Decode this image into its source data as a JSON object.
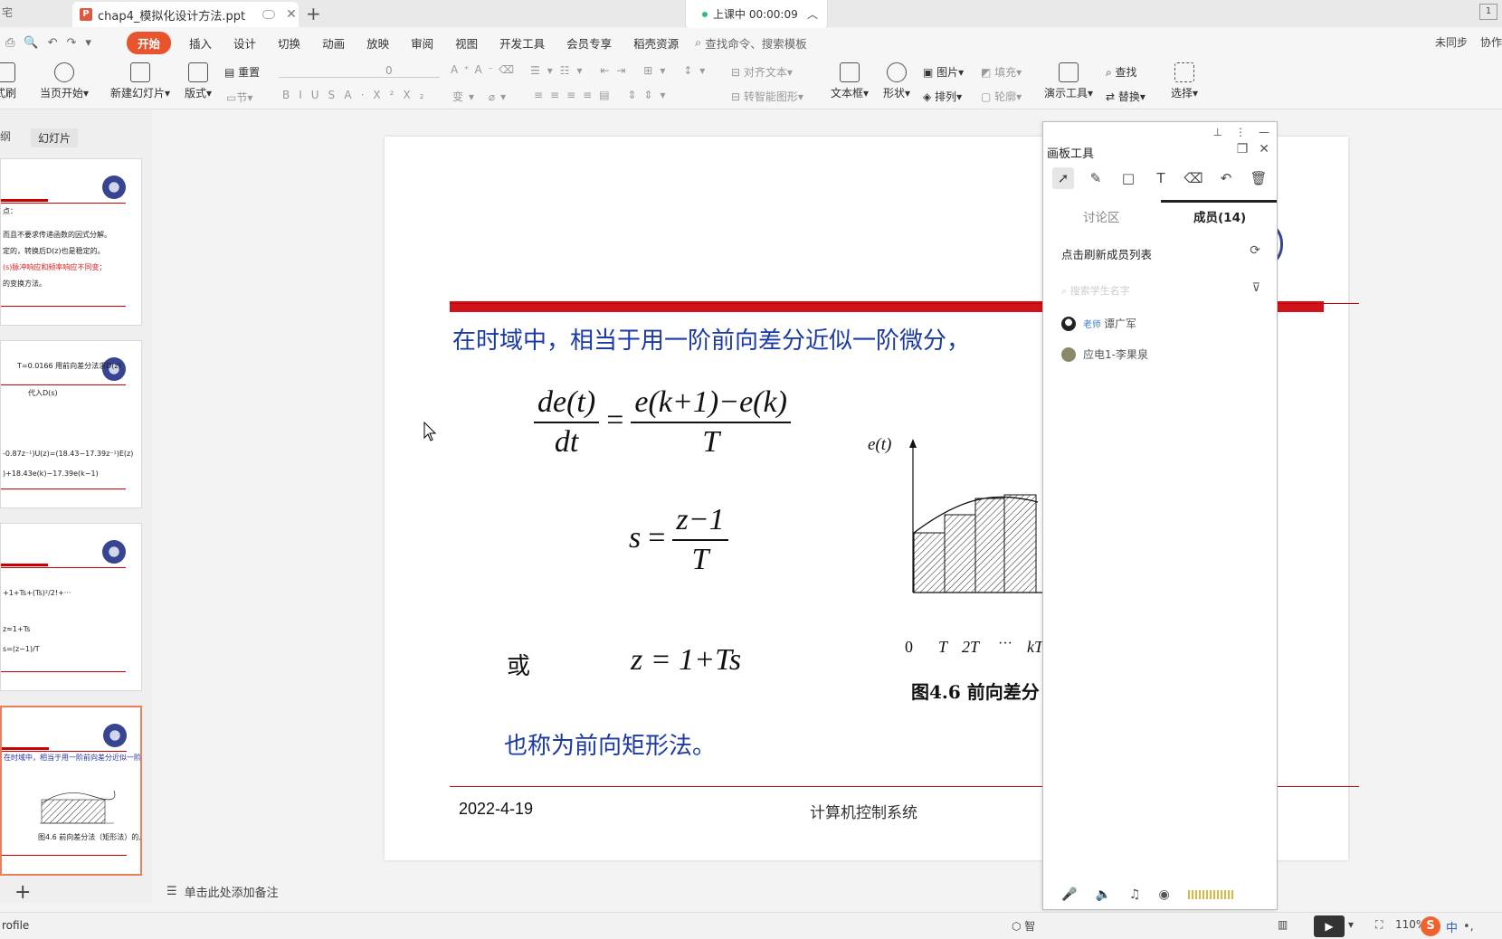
{
  "titlebar": {
    "prev_tab": "宅",
    "active_tab": "chap4_模拟化设计方法.ppt",
    "new_tab": "+",
    "class_status": "上课中 00:00:09",
    "right_badge": "1"
  },
  "menubar": {
    "items": [
      "开始",
      "插入",
      "设计",
      "切换",
      "动画",
      "放映",
      "审阅",
      "视图",
      "开发工具",
      "会员专享",
      "稻壳资源"
    ],
    "search": "查找命令、搜索模板",
    "right": [
      "未同步",
      "协作"
    ]
  },
  "ribbon": {
    "format_painter": "式刷",
    "play_current": "当页开始",
    "new_slide": "新建幻灯片",
    "layout": "版式",
    "reset": "重置",
    "section": "节",
    "font_size": "0",
    "align_text": "对齐文本",
    "convert_smartart": "转智能图形",
    "textbox": "文本框",
    "shape": "形状",
    "picture": "图片",
    "arrange": "排列",
    "fill": "填充",
    "outline": "轮廓",
    "present_tool": "演示工具",
    "find": "查找",
    "replace": "替换",
    "select": "选择"
  },
  "leftpanel": {
    "tabs": [
      "纲",
      "幻灯片"
    ],
    "thumb1": {
      "l1": "点：",
      "l2": "而且不要求传递函数的因式分解。",
      "l3": "定的，转换后D(z)也是稳定的。",
      "l4": "(s)脉冲响应和频率响应不同变；",
      "l5": "的变换方法。"
    },
    "thumb2": {
      "l1": "T=0.0166  用前向差分法求D(z)",
      "l2": "代入D(s)",
      "l3": "-0.87z⁻¹)U(z)=(18.43−17.39z⁻¹)E(z)",
      "l4": ")+18.43e(k)−17.39e(k−1)"
    },
    "thumb3": {
      "l1": "+1+Ts+(Ts)²/2!+···",
      "l2": "z≈1+Ts",
      "l3": "s=(z−1)/T"
    },
    "thumb4": {
      "l1": "在时域中，相当于用一阶前向差分近似一阶微分，即",
      "l2": "图4.6 前向差分法（矩形法）的几何意义"
    },
    "add": "+"
  },
  "slide": {
    "line1": "在时域中，相当于用一阶前向差分近似一阶微分，",
    "eq1": {
      "num_left": "de(t)",
      "den_left": "dt",
      "num_right": "e(k+1)−e(k)",
      "den_right": "T"
    },
    "eq2": {
      "lhs": "s",
      "num": "z−1",
      "den": "T"
    },
    "or_word": "或",
    "eq3": "z = 1+Ts",
    "also": "也称为前向矩形法。",
    "figure": {
      "y_label": "e(t)",
      "ticks": [
        "0",
        "T",
        "2T",
        "···",
        "kT"
      ],
      "caption": "图4.6 前向差分"
    },
    "footer_date": "2022-4-19",
    "footer_course": "计算机控制系统"
  },
  "notes": {
    "text": "单击此处添加备注"
  },
  "board": {
    "title": "画板工具",
    "tabs": [
      "讨论区",
      "成员(14)"
    ],
    "refresh": "点击刷新成员列表",
    "search_placeholder": "搜索学生名字",
    "members": [
      {
        "role": "老师",
        "name": "谭广军"
      },
      {
        "role": "",
        "name": "应电1-李果泉"
      }
    ]
  },
  "statusbar": {
    "left": "rofile",
    "smart": "智",
    "zoom": "110%",
    "ime": "中"
  },
  "colors": {
    "accent": "#e8542e",
    "slide_blue": "#1b3aa6",
    "slide_red": "#d0121b"
  }
}
